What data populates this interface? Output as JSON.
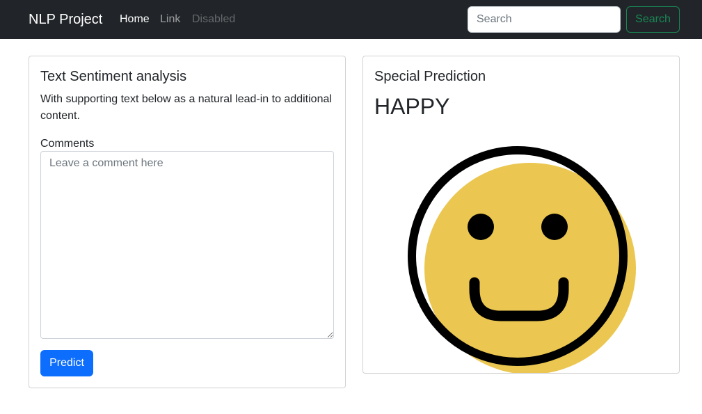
{
  "navbar": {
    "brand": "NLP Project",
    "links": [
      {
        "label": "Home",
        "state": "active"
      },
      {
        "label": "Link",
        "state": "normal"
      },
      {
        "label": "Disabled",
        "state": "disabled"
      }
    ],
    "search": {
      "placeholder": "Search",
      "value": "",
      "button_label": "Search"
    }
  },
  "left_card": {
    "title": "Text Sentiment analysis",
    "text": "With supporting text below as a natural lead-in to additional content.",
    "comments_label": "Comments",
    "comments_placeholder": "Leave a comment here",
    "comments_value": "",
    "predict_label": "Predict"
  },
  "right_card": {
    "title": "Special Prediction",
    "prediction": "HAPPY",
    "image_icon": "happy-face-icon"
  },
  "colors": {
    "navbar_bg": "#212529",
    "primary": "#0d6efd",
    "success": "#198754",
    "smiley_fill": "#EBC751",
    "smiley_outline": "#000000"
  }
}
